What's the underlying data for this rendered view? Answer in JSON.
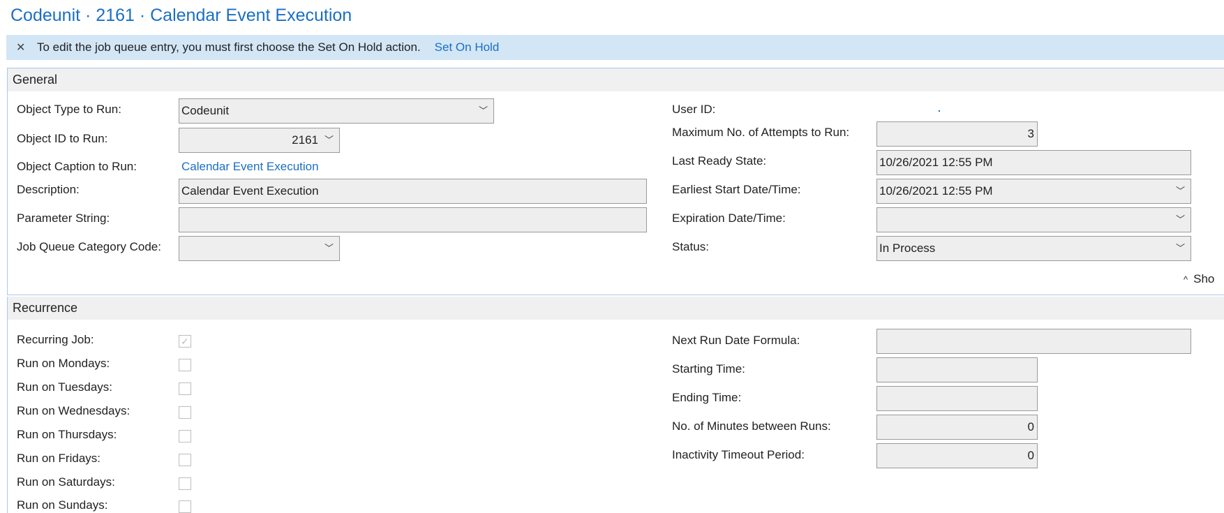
{
  "title": "Codeunit · 2161 · Calendar Event Execution",
  "banner": {
    "close_glyph": "✕",
    "message": "To edit the job queue entry, you must first choose the Set On Hold action.",
    "action": "Set On Hold"
  },
  "general": {
    "header": "General",
    "object_type_label": "Object Type to Run:",
    "object_type_value": "Codeunit",
    "object_id_label": "Object ID to Run:",
    "object_id_value": "2161",
    "object_caption_label": "Object Caption to Run:",
    "object_caption_value": "Calendar Event Execution",
    "description_label": "Description:",
    "description_value": "Calendar Event Execution",
    "parameter_label": "Parameter String:",
    "parameter_value": "",
    "category_label": "Job Queue Category Code:",
    "category_value": "",
    "user_id_label": "User ID:",
    "user_id_value": "",
    "max_attempts_label": "Maximum No. of Attempts to Run:",
    "max_attempts_value": "3",
    "last_ready_label": "Last Ready State:",
    "last_ready_value": "10/26/2021 12:55 PM",
    "earliest_start_label": "Earliest Start Date/Time:",
    "earliest_start_value": "10/26/2021 12:55 PM",
    "expiration_label": "Expiration Date/Time:",
    "expiration_value": "",
    "status_label": "Status:",
    "status_value": "In Process",
    "show_more": "Sho"
  },
  "recurrence": {
    "header": "Recurrence",
    "recurring_label": "Recurring Job:",
    "recurring_checked": true,
    "days": [
      {
        "label": "Run on Mondays:",
        "checked": false
      },
      {
        "label": "Run on Tuesdays:",
        "checked": false
      },
      {
        "label": "Run on Wednesdays:",
        "checked": false
      },
      {
        "label": "Run on Thursdays:",
        "checked": false
      },
      {
        "label": "Run on Fridays:",
        "checked": false
      },
      {
        "label": "Run on Saturdays:",
        "checked": false
      },
      {
        "label": "Run on Sundays:",
        "checked": false
      }
    ],
    "next_run_label": "Next Run Date Formula:",
    "next_run_value": "",
    "starting_time_label": "Starting Time:",
    "starting_time_value": "",
    "ending_time_label": "Ending Time:",
    "ending_time_value": "",
    "minutes_between_label": "No. of Minutes between Runs:",
    "minutes_between_value": "0",
    "inactivity_label": "Inactivity Timeout Period:",
    "inactivity_value": "0"
  },
  "icons": {
    "chevron": "chevron-down-icon",
    "caret_up": "caret-up-icon",
    "check": "checkmark-icon"
  },
  "colors": {
    "accent": "#1a6fc4",
    "banner_bg": "#d3e6f6",
    "section_border": "#a8c8ee"
  }
}
